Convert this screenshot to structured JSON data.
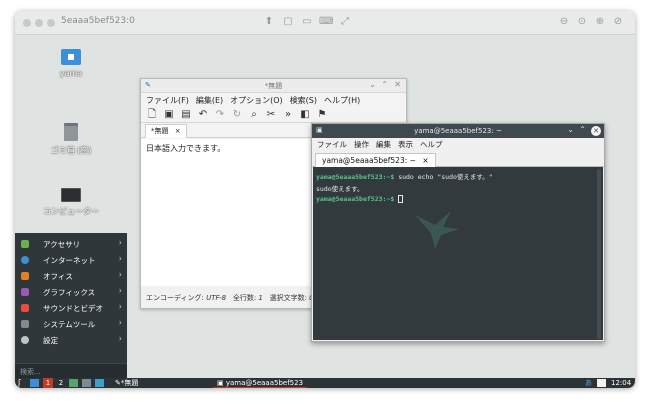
{
  "vnc": {
    "title": "5eaaa5bef523:0"
  },
  "desktop": {
    "icons": [
      {
        "label": "yama"
      },
      {
        "label": "ゴミ箱 (空)"
      },
      {
        "label": "コンピューター"
      }
    ]
  },
  "editor": {
    "title": "*無題",
    "menu": [
      "ファイル(F)",
      "編集(E)",
      "オプション(O)",
      "検索(S)",
      "ヘルプ(H)"
    ],
    "tab_label": "*無題",
    "tab_close": "×",
    "content": "日本語入力できます。",
    "status": {
      "encoding_label": "エンコーディング:",
      "encoding_value": "UTF-8",
      "lines_label": "全行数:",
      "lines_value": "1",
      "selection_label": "選択文字数:",
      "selection_value": "0"
    }
  },
  "terminal": {
    "title": "yama@5eaaa5bef523: ~",
    "menu": [
      "ファイル",
      "操作",
      "編集",
      "表示",
      "ヘルプ"
    ],
    "tab_label": "yama@5eaaa5bef523: ~",
    "tab_close": "×",
    "lines": [
      {
        "prompt": "yama@5eaaa5bef523:~$",
        "text": " sudo echo \"sudo使えます。\""
      },
      {
        "prompt": "",
        "text": "sudo使えます。"
      },
      {
        "prompt": "yama@5eaaa5bef523:~$",
        "text": " "
      }
    ]
  },
  "start_menu": {
    "items": [
      {
        "label": "アクセサリ",
        "arrow": "›",
        "color": "#6ab04c"
      },
      {
        "label": "インターネット",
        "arrow": "›",
        "color": "#3b8fd6"
      },
      {
        "label": "オフィス",
        "arrow": "›",
        "color": "#e67e22"
      },
      {
        "label": "グラフィックス",
        "arrow": "›",
        "color": "#9b59b6"
      },
      {
        "label": "サウンドとビデオ",
        "arrow": "›",
        "color": "#e74c3c"
      },
      {
        "label": "システムツール",
        "arrow": "›",
        "color": "#7f8c8d"
      },
      {
        "label": "設定",
        "arrow": "›",
        "color": "#bdc3c7"
      }
    ],
    "search_placeholder": "検索..."
  },
  "taskbar": {
    "workspace1": "1",
    "workspace2": "2",
    "task_editor": "*無題",
    "task_terminal": "yama@5eaaa5bef523",
    "ime": "あ",
    "clock": "12:04"
  },
  "colors": {
    "desktop_bg": "#dfe3e1",
    "terminal_bg": "#323a3e",
    "prompt_green": "#58c38a",
    "taskbar_bg": "#2c3336",
    "workspace_active": "#c0392b"
  }
}
